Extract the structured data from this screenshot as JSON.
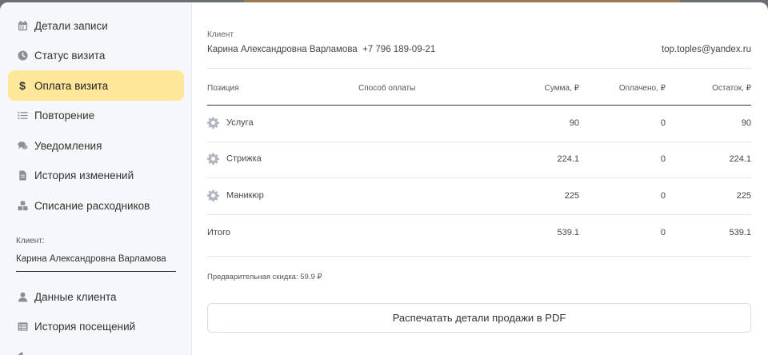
{
  "sidebar": {
    "items": [
      {
        "label": "Детали записи",
        "icon": "calendar-icon"
      },
      {
        "label": "Статус визита",
        "icon": "clock-icon"
      },
      {
        "label": "Оплата визита",
        "icon": "dollar-icon"
      },
      {
        "label": "Повторение",
        "icon": "list-icon"
      },
      {
        "label": "Уведомления",
        "icon": "chat-icon"
      },
      {
        "label": "История изменений",
        "icon": "document-icon"
      },
      {
        "label": "Списание расходников",
        "icon": "cubes-icon"
      }
    ],
    "client_caption": "Клиент:",
    "client_name": "Карина  Александровна Варламова",
    "client_items": [
      {
        "label": "Данные клиента",
        "icon": "user-icon"
      },
      {
        "label": "История посещений",
        "icon": "table-icon"
      }
    ]
  },
  "main": {
    "client_label": "Клиент",
    "client_name": "Карина Александровна Варламова",
    "client_phone": "+7 796 189-09-21",
    "client_email": "top.toples@yandex.ru",
    "table": {
      "headers": [
        "Позиция",
        "Способ оплаты",
        "Сумма, ₽",
        "Оплачено, ₽",
        "Остаток, ₽"
      ],
      "rows": [
        {
          "name": "Услуга",
          "sum": "90",
          "paid": "0",
          "rest": "90"
        },
        {
          "name": "Стрижка",
          "sum": "224.1",
          "paid": "0",
          "rest": "224.1"
        },
        {
          "name": "Маникюр",
          "sum": "225",
          "paid": "0",
          "rest": "225"
        }
      ],
      "total": {
        "label": "Итого",
        "sum": "539.1",
        "paid": "0",
        "rest": "539.1"
      }
    },
    "discount": "Предварительная скидка: 59.9 ₽",
    "pdf_button": "Распечатать детали продажи в PDF"
  },
  "colors": {
    "active_nav": "#fde89a",
    "sidebar_bg": "#f6f7fb",
    "backdrop": "#6b6f73"
  }
}
